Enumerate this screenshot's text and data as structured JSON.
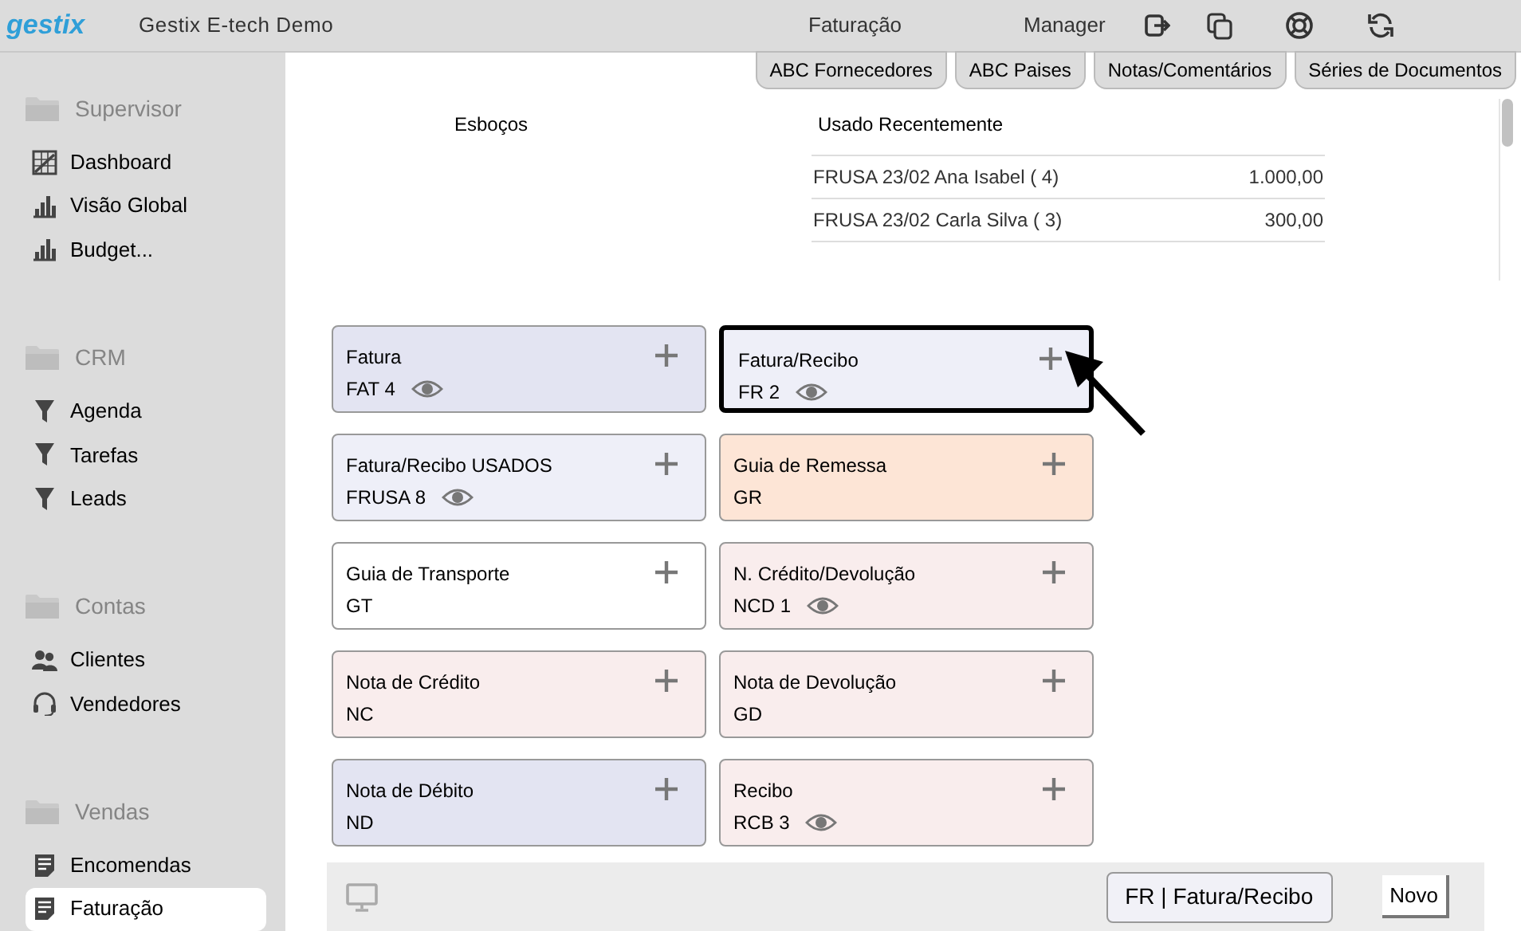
{
  "header": {
    "logo": "gestix",
    "company": "Gestix E-tech Demo",
    "title": "Faturação",
    "user": "Manager"
  },
  "tabs": [
    {
      "label": "ABC Fornecedores"
    },
    {
      "label": "ABC Paises"
    },
    {
      "label": "Notas/Comentários"
    },
    {
      "label": "Séries de Documentos"
    }
  ],
  "sidebar": {
    "groups": [
      {
        "label": "Supervisor",
        "items": [
          {
            "label": "Dashboard",
            "kind": "dashboard",
            "selected": false
          },
          {
            "label": "Visão Global",
            "kind": "chart",
            "selected": false
          },
          {
            "label": "Budget...",
            "kind": "chart",
            "selected": false
          }
        ]
      },
      {
        "label": "CRM",
        "items": [
          {
            "label": "Agenda",
            "kind": "filter",
            "selected": false
          },
          {
            "label": "Tarefas",
            "kind": "filter",
            "selected": false
          },
          {
            "label": "Leads",
            "kind": "filter",
            "selected": false
          }
        ]
      },
      {
        "label": "Contas",
        "items": [
          {
            "label": "Clientes",
            "kind": "people",
            "selected": false
          },
          {
            "label": "Vendedores",
            "kind": "headset",
            "selected": false
          }
        ]
      },
      {
        "label": "Vendas",
        "items": [
          {
            "label": "Encomendas",
            "kind": "document",
            "selected": false
          },
          {
            "label": "Faturação",
            "kind": "document",
            "selected": true
          }
        ]
      }
    ]
  },
  "drafts": {
    "title": "Esboços"
  },
  "recent": {
    "title": "Usado Recentemente",
    "rows": [
      {
        "description": "FRUSA 23/02 Ana Isabel ( 4)",
        "amount": "1.000,00"
      },
      {
        "description": "FRUSA 23/02 Carla Silva ( 3)",
        "amount": "300,00"
      }
    ]
  },
  "document_types": [
    {
      "name": "Fatura",
      "code": "FAT 4",
      "viewable": true,
      "selected": false,
      "color": "#e3e4f2"
    },
    {
      "name": "Fatura/Recibo",
      "code": "FR 2",
      "viewable": true,
      "selected": true,
      "color": "#eeeff8"
    },
    {
      "name": "Fatura/Recibo USADOS",
      "code": "FRUSA 8",
      "viewable": true,
      "selected": false,
      "color": "#eeeff8"
    },
    {
      "name": "Guia de Remessa",
      "code": "GR",
      "viewable": false,
      "selected": false,
      "color": "#fde5d6"
    },
    {
      "name": "Guia de Transporte",
      "code": "GT",
      "viewable": false,
      "selected": false,
      "color": "#ffffff"
    },
    {
      "name": "N. Crédito/Devolução",
      "code": "NCD 1",
      "viewable": true,
      "selected": false,
      "color": "#f9eded"
    },
    {
      "name": "Nota de Crédito",
      "code": "NC",
      "viewable": false,
      "selected": false,
      "color": "#f9eded"
    },
    {
      "name": "Nota de Devolução",
      "code": "GD",
      "viewable": false,
      "selected": false,
      "color": "#f9eded"
    },
    {
      "name": "Nota de Débito",
      "code": "ND",
      "viewable": false,
      "selected": false,
      "color": "#e3e4f2"
    },
    {
      "name": "Recibo",
      "code": "RCB 3",
      "viewable": true,
      "selected": false,
      "color": "#f9eded"
    }
  ],
  "footer": {
    "current_type": "FR | Fatura/Recibo",
    "new_button": "Novo"
  }
}
